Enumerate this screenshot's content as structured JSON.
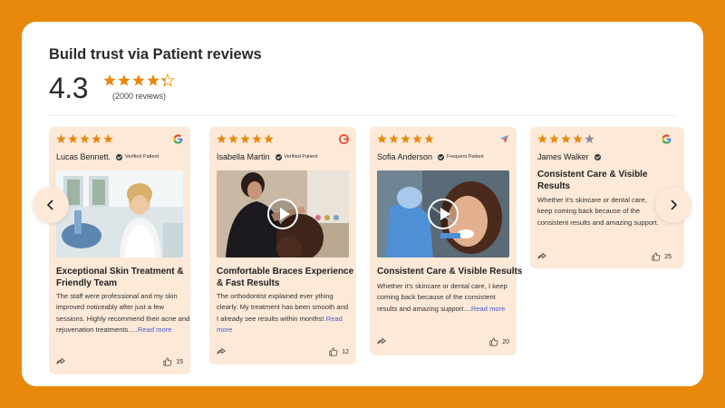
{
  "header": {
    "title": "Build trust via Patient reviews",
    "rating": "4.3",
    "rating_value": 4.3,
    "reviews_count": "(2000 reviews)"
  },
  "colors": {
    "accent": "#E8890B",
    "card_bg": "#FCE9D7",
    "star": "#E8890B",
    "star_empty": "#8A8F9C",
    "link": "#4A5BD4"
  },
  "reviews": [
    {
      "name": "Lucas Bennett.",
      "badge": "Verified Patient",
      "stars": 5,
      "source_icon": "google-icon",
      "has_video": false,
      "title": "Exceptional Skin Treatment & Friendly Team",
      "text": "The staff were professional and my skin improved noticeably after just a few sessions. Highly recommend their acne and rejuvenation treatments.....",
      "more": "Read more",
      "likes": "15"
    },
    {
      "name": "Isabella Martin",
      "badge": "Verified Patient",
      "stars": 5,
      "source_icon": "red-source-icon",
      "has_video": true,
      "title": "Comfortable Braces Experience & Fast Results",
      "text": "The orthodontist explained ever ything clearly. My treatment has been smooth and I already see results within months!.",
      "more": "Read more",
      "likes": "12"
    },
    {
      "name": "Sofia Anderson",
      "badge": "Frequent Patient",
      "stars": 5,
      "source_icon": "navigation-arrow-icon",
      "has_video": true,
      "title": "Consistent Care & Visible Results",
      "text": "Whether it's skincare or dental care, I keep coming back because of the consistent results and amazing support....",
      "more": "Read more",
      "likes": "20"
    },
    {
      "name": "James Walker",
      "badge": "",
      "stars": 4,
      "source_icon": "google-icon",
      "has_video": false,
      "title": "Consistent Care & Visible Results",
      "text": "Whether it's skincare or dental care, keep coming back because of the consistent results and amazing support.",
      "more": "",
      "likes": "25"
    }
  ],
  "nav": {
    "prev_icon": "chevron-left-icon",
    "next_icon": "chevron-right-icon"
  }
}
